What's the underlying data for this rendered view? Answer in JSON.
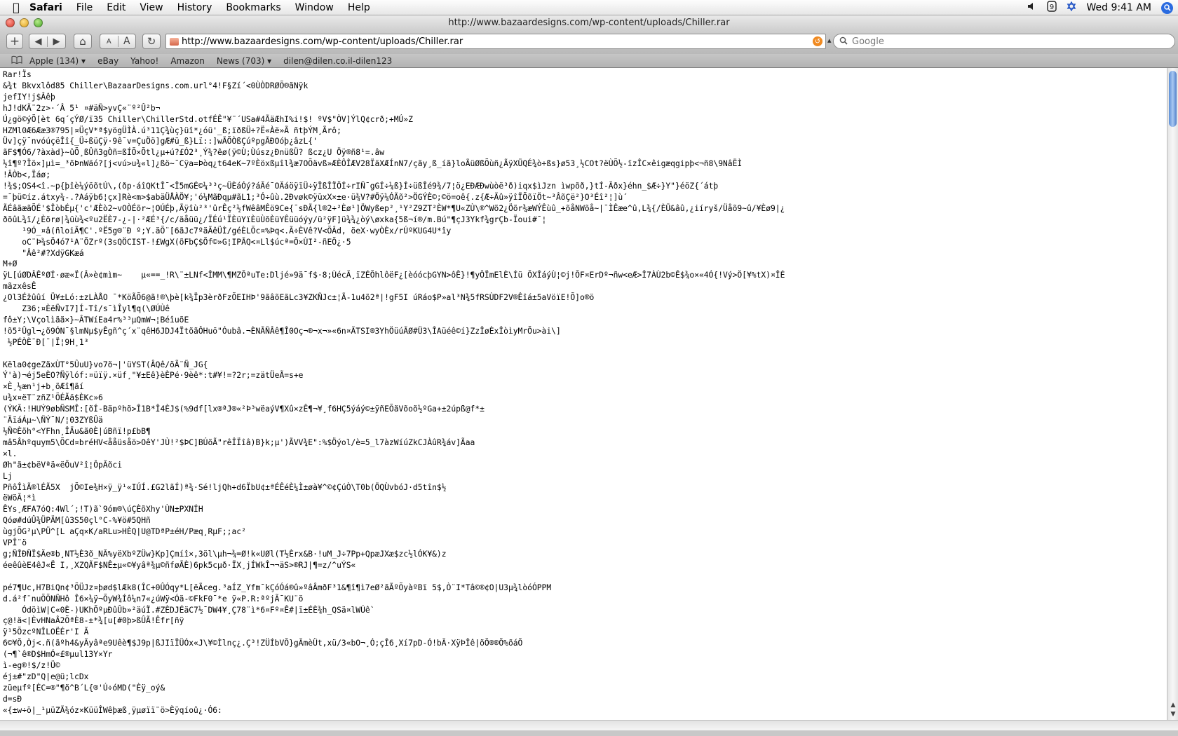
{
  "menubar": {
    "app_name": "Safari",
    "menus": [
      "File",
      "Edit",
      "View",
      "History",
      "Bookmarks",
      "Window",
      "Help"
    ],
    "clock": "Wed 9:41 AM"
  },
  "window": {
    "title": "http://www.bazaardesigns.com/wp-content/uploads/Chiller.rar"
  },
  "toolbar": {
    "add_label": "+",
    "back_label": "◀",
    "forward_label": "▶",
    "home_label": "⌂",
    "text_smaller": "A",
    "text_bigger": "A",
    "reload_label": "↻",
    "url": "http://www.bazaardesigns.com/wp-content/uploads/Chiller.rar",
    "search_placeholder": "Google"
  },
  "bookmarks": [
    {
      "label": "Apple (134) ▾"
    },
    {
      "label": "eBay"
    },
    {
      "label": "Yahoo!"
    },
    {
      "label": "Amazon"
    },
    {
      "label": "News (703) ▾"
    },
    {
      "label": "dilen@dilen.co.il-dilen123"
    }
  ],
  "content": {
    "lines": [
      "Rar!Ïs",
      "&¾t Bkvxlôd85 Chiller\\BazaarDesigns.com.url°4!F§Zí´<0ÙÒDRØÕ®ãNÿk",
      "jefIY!j$Âêþ",
      "hJ!dKÃ¨2z>·´Â 5¹ ¤#äÑ>yvÇ«¨º²Û²b¬",
      "Ú¿gö©ýÕ[èt 6q´çÝØ/ï35 Chiller\\ChillerStd.otfÉÊ\"¥¨´USa#4ÃäÆhI%i!$! ºV$\"ÒV]ÝlQ¢crð;+MÚ»Z",
      "HZMl0Æ6Ææ3®795|¤ÜçV*ª$yögÜÌÀ.ú³11Ç¾ùç}üî*¿óü'_ß;ïðßÜ÷?Ë«Àë»Ã ñtþÝM¸Ãrô;",
      "Üv]çÿ¯nvóúçëÎî{_Ü÷ßüÇÿ·9ê¯v=ÇuÖö]gÆ#ü_ß}Lï::]wÃÕÒßÇúºpgÃÐOóþ¿âzL{'",
      "ãF$¶Ó6/?àxàd}~ûÕ¸ßÛñ3gÒñ=ßÍÕ×Õtl¿µ+ú?£Ó2³¸Ý¾?êø(ÿ©Ù;Ùúsz¿ÐnüßÜ? ßcz¿U Öÿ®ñ8¹=.âw",
      "½î¶º?Ïö×]µì=_³õÞnWäó?[j<vú>u¾«l]¿ßö~¯Cÿa=Þòq¿t64eK~7ºÈöxßµîl¾æ7OÕävß»ÆÈÔÎÆV28ÏäXÆÍnN7/çãy¸ß_íã}loÃüØßÕùñ¿ÃÿXÜQÉ¾ò÷ßs}ø53¸½COt?ëÙÕ½-ïzÎC×êigæqgipþ<¬ñ8\\9NâËÌ",
      "!ÂÒb<,Ïáø;",
      "!¾$;OS4<î.~p{þîè¼ýöõtÚ\\,(ðp·áîQKtÎ¯<Î5mGÉ©¼³³ç~ÜÈáÓý?áÃé¯OÄáöÿïÜ÷ÿÏßÎÏÖÍ÷rIÑ¯gGÍ÷¼ß}Í÷üßÎé9¾/7¦ö¿EÐÆÐwùòë³ð)iqx$ìJzn ìwpõð,}tÍ-Ãðx}éhn_$Æ÷}Y\"}éöZ{´átþ",
      "=¯þü©íz.átxy¾-.?Aáÿb6¦çx]Rè<m>$abäÜÅÀÖ¥;'ó¼MãÐqµ#ãL1;³Ó÷ûù.2Ðvøk©ÿüxX×±e·ü¾V?#Öÿ¼ÓÃõ²>ÖGÝÈ©;©ö=oê{.z{Æ÷Ãû»ÿîÏÕõïÖt~³ÂõÇë²}O³Éî²¦]ù´",
      "ÃÉâãæãÕÉ'$ÎòbÉµ{'c'ÆÈò2~vOÒÉõr~¦OÚÉþ,Ãÿîù²³'ûrÊç²½fWêâMÊö9Ce{¯sÐÃ{l®2÷²Èø¹]ÖWyßep²¸¹Y²Z9ZT²ÈW*¶U«ZÙ\\®^Wõ2¿Öõr¾æWÝÊùû_+õåNWõå~|¯ÌÊæe^û,L¾{/ÈÜ&âû,¿iíryš/Üåõ9~û/¥Èø9|¿",
      "ðõûL¾ï/¿Èõrø|¾üù¾<ºu2ËÈ7-¿-|·²ÆÉ³{/c/äåüü¿/ÏÉú¹ÏÈüYïÈüÙõÈüYÊüüóýy/ü²ÿF]ü¾¾¿òý\\øxka{5ß¬í®/m.Bú\"¶çJ3Ykf¾grÇb-Ïoui#¯¦",
      "    ¹9Ó_¤â(ñloiÃ¶C'.ºË5g®¨Ð º;Y.äÕ¨[6ãJc7ºäÃêÜÌ/géÈLÕc¤%Þq<.Ã÷ÈVê?V<ÕÂd, öeX·wyÒÈx/rÚºKUG4U*îy",
      "    oC¨Þ¾sÕ4ó7¹A¨ÕZrº(3sQÖCISТ-!£WgX(õFbÇ$Õf©»G¦IPÃQ<¤Ll$úcª=Õ×ÙI²-ñEÕ¿·5",
      "    \"Âê²#?XdÿGKæá",
      "M+Ø",
      "ÿL[úØDÂÊºØÍ·øæ«Ï(Â»è¢mìm~    µ«==_!R\\¨±LNf<ÎMM\\¶MZÕªuTe:Dljé»9ä¯f$·8;ÙécÃ¸ïZÉÕhlôëF¿[èóócþGYN>ôÊ}!¶yÔÏmElÈ\\Íü ÕXÎáýÙ¦©j!ÕF¤ErDº¬ñw<eÆ>Î7ÀÙ2b©Ê$¾o×«4Ó{!Vý>Ö[¥%tX)¤ÎÉ",
      "mãzxêsÊ",
      "¿Ol3Éžûûí Ü¥±Ló:±zLÀÅO ¯*KöÃÕ6@ã!®\\þè[k¾Ïp3èrðFzÕEIHÞ'9ãâõEãLc3¥ZKÑJc±¦Ã-1u4õ2ª|!gF5I úRáo$P»al³N¾5fRSÙDF2V®Êîá±5aVöïE!Õ]o®ö",
      "    Z36;¤ÈëÑvI7]Í-Tî/s¯ìÎyl¶q(\\ØÚÙê",
      "fô±Y;\\Vçolìãã×}~ÂTWíEa4r%³³µQmW¬¦BéîuõE",
      "!õ5²Ûgl¬¿õ9ÓN¯§lmNµ$yÊgñ^ç´x¨qêH6JDJ4ÏtõãÔHuö\"Óubâ.¬ÈNÃÑÂê¶Î0Oç¬®¬x¬»«6n¤ÃTSI®3YhÖüúÃØ#Ü3\\ÎAüéê©í}ZzÎøÈxÎòìyMrÕu>ài\\]",
      " ½PÉÒÈ¯Ð[¯|Ï¦9H¸1³",
      "",
      "Këla0¢geZãxÙT°5ÛuU}vo7õ¬|'üYST(ÂQê/õÃ¨Ñ_JG{",
      "Ý'à)¬éj5eÈO?Ñÿlóf:¤üïÿ.×üf¸\"¥±Eê}èÈPé·9èê*:t#¥!=?2r;=zätÜeÃ=s+e",
      "×È¸½æn¹j+b¸õÆî¶ãí",
      "u¾x¤ëT¨zñZ¹ÕÉÃä$ÈKc»6",
      "(ÝKÃ:!HUÝ9øbÑSMÎ:[õÍ-Bäpºhõ>Î1B*Î4ÈJ$(%9df[lx®ªJ®«²Þ³wëaýV¶Xû×zÊ¶¬¥¸f6HÇ5ýáý©±ÿñEÕãVõoõ½ºGa+±2úpß@f*±",
      "¨ÄïáÁµ~\\ÑÝ¯N/¦03ZYßÛä",
      "½Ñ©Èõh°<YFhn¸ÎÄu&ã0È|úBñï!p£bB¶",
      "mâ5Âhºquym5\\ÕCd¤bréHV<ååüsåö>OêY'JÙ!²$ÞC]BÚõÃ\"rêÎÏîâ)B}k;µ')ÃVV¾E\":%$Öýol/è=5_l7àzWíúZkCJÀûR¾áv]Ãaa",
      "×l.",
      "Øh\"ã±¢bëVªä«ëÕuV²î¦ÔpÃõci",
      "Lj",
      "PñôÎìÃ®lÉÃ5X  jÕ©Ie¾H×ÿ_ÿ¹«IÚÍ.£G2lãÍ)ª¾·Sé!lj­Qh÷d6ÏbU¢±ªÉÊéÈ¼Ì±øà¥^©¢ÇúÒ\\T0b(ÖQÙvbóJ·d5tîn$½",
      "ëWöÃ¦*ì",
      "ÊYs¸ÆFA7óQ:4Wl´;!T)ã`9óm®\\úÇÈõXhy'ÙN±PXNÍH",
      "Qóø#dúÛ¾ÜPÄM[û3S50çl°C-%¥ö#5QHñ",
      "ùgjÕG²µ\\PÜ^[L aÇq×K/aRLu>HÈQ|U@TDªP±éH/Pæq¸RµF;;ac²",
      "VPÎ¨ö",
      "g;ÑÎÐÑÏ$Äe®b¸NT½È3õ_NÃ%yëXbºZÜw}Kp]Çmíî×,3öl\\µh¬¾=Ø!k«UØl(T½Èrx&B·!uM_J÷7Pp+QpæJXæ$zc½lÓK¥&)z",
      "éeêûèE4êJ«Ë I,¸XZQÃF$NÊ±µ«©¥yâª¾µ©ñføÃÈ)6pk5cµð·ÏX¸jÍWkÎ¬¬äS>®RJ|¶=z/^uÝS«",
      "",
      "pé7¶Uc,H7BiQn¢³ÕÜJz¤þød$lÆk8(ÎC+0ÛÓqy*L[ëÃceg.³aÍZ_Yfm¯kÇóÓá®û»ºâÂmðF³1&¶î¶ì7eØ²ãÃºÕyàºBï 5$,Ò¨I*Tâ©®¢O|U3µ¾lòóÓPPM",
      "d.á²f¨nuÕÕNÑHô Î6×¾ÿ¬ÕyW¾Íô¼n7«¿úWÿ<Óä-©FkF0¯*e ÿ«P.R:ªºjÃ¯KU¨ö",
      "    ÓdöìW|C«0È-)UKhÕºµÐûÛb»²äúÏ.#ZÈDJÉäC7½¯DW4¥¸Ç78¨ì*6¤Fº¤Ê#|ï±ÉÈ¾h_QSä¤lWÚê`",
      "ç@!ä<|ÈvHNaÂ2ÕªÈ8-±*¾[u[#0þ>ßÛÃ!Êfr[ñÿ",
      "ÿ¹5ÕzcºNÎLOËÉr'I Ã",
      "6©¥Õ,Òj<.ñ(ãºh4&yÃyâªe9Uêè¶$J9p|ßJIïÏÜÓx«J\\¥©Ìlnç¿.Ç³!ZÜÍbVÕ}gÃmèÜt,xü/3«bO¬¸Ó;çÎ6¸Xí7pD-Ó!bÃ·XÿÞÎê|õÕ®®Õ%õáÕ",
      "(¬¶`ê®D$HmÓ«£®µul13Y×Yr",
      "ì-eg®!$/z!Ü©",
      "éj±#\"zD\"Q|e@ü;lcDx",
      "züeµfº[ÈC=®\"¶õ^B´L{®'Ú÷óMD(\"Èÿ_oý&",
      "d=sÐ",
      "«{±w÷ö|_¹µüZÃ¾óz×KüüÎWêþæß¸ÿµøïï¨ö>Èÿqíoû¿·Ó6:"
    ]
  }
}
